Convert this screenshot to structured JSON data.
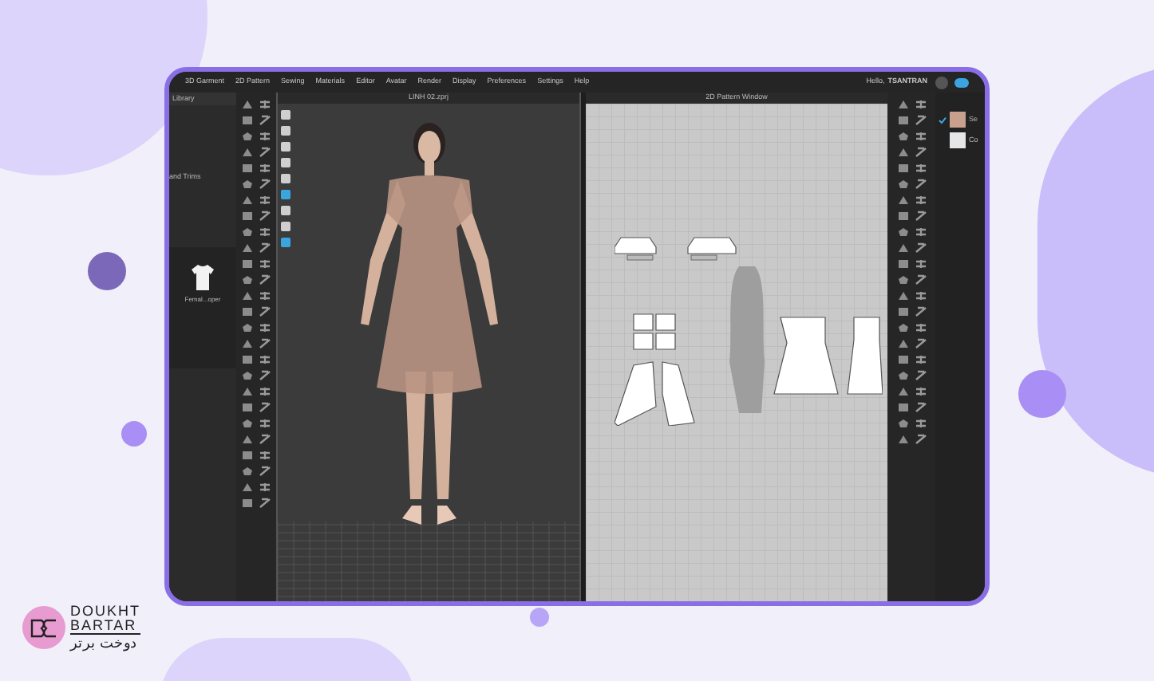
{
  "menu": [
    "3D Garment",
    "2D Pattern",
    "Sewing",
    "Materials",
    "Editor",
    "Avatar",
    "Render",
    "Display",
    "Preferences",
    "Settings",
    "Help"
  ],
  "user": {
    "greeting": "Hello,",
    "name": "TSANTRAN"
  },
  "library": {
    "title": "Library",
    "items": [
      "and Trims"
    ],
    "thumbnail_label": "Femal...oper"
  },
  "window_3d": {
    "title": "LINH 02.zprj"
  },
  "window_2d": {
    "title": "2D Pattern Window"
  },
  "fabrics": [
    {
      "label": "Se",
      "color": "#c9a08e",
      "checked": true
    },
    {
      "label": "Co",
      "color": "#e4e6e8",
      "checked": false
    }
  ],
  "logo": {
    "line_1": "DOUKHT",
    "line_2": "BARTAR",
    "line_3": "دوخت برتر"
  }
}
